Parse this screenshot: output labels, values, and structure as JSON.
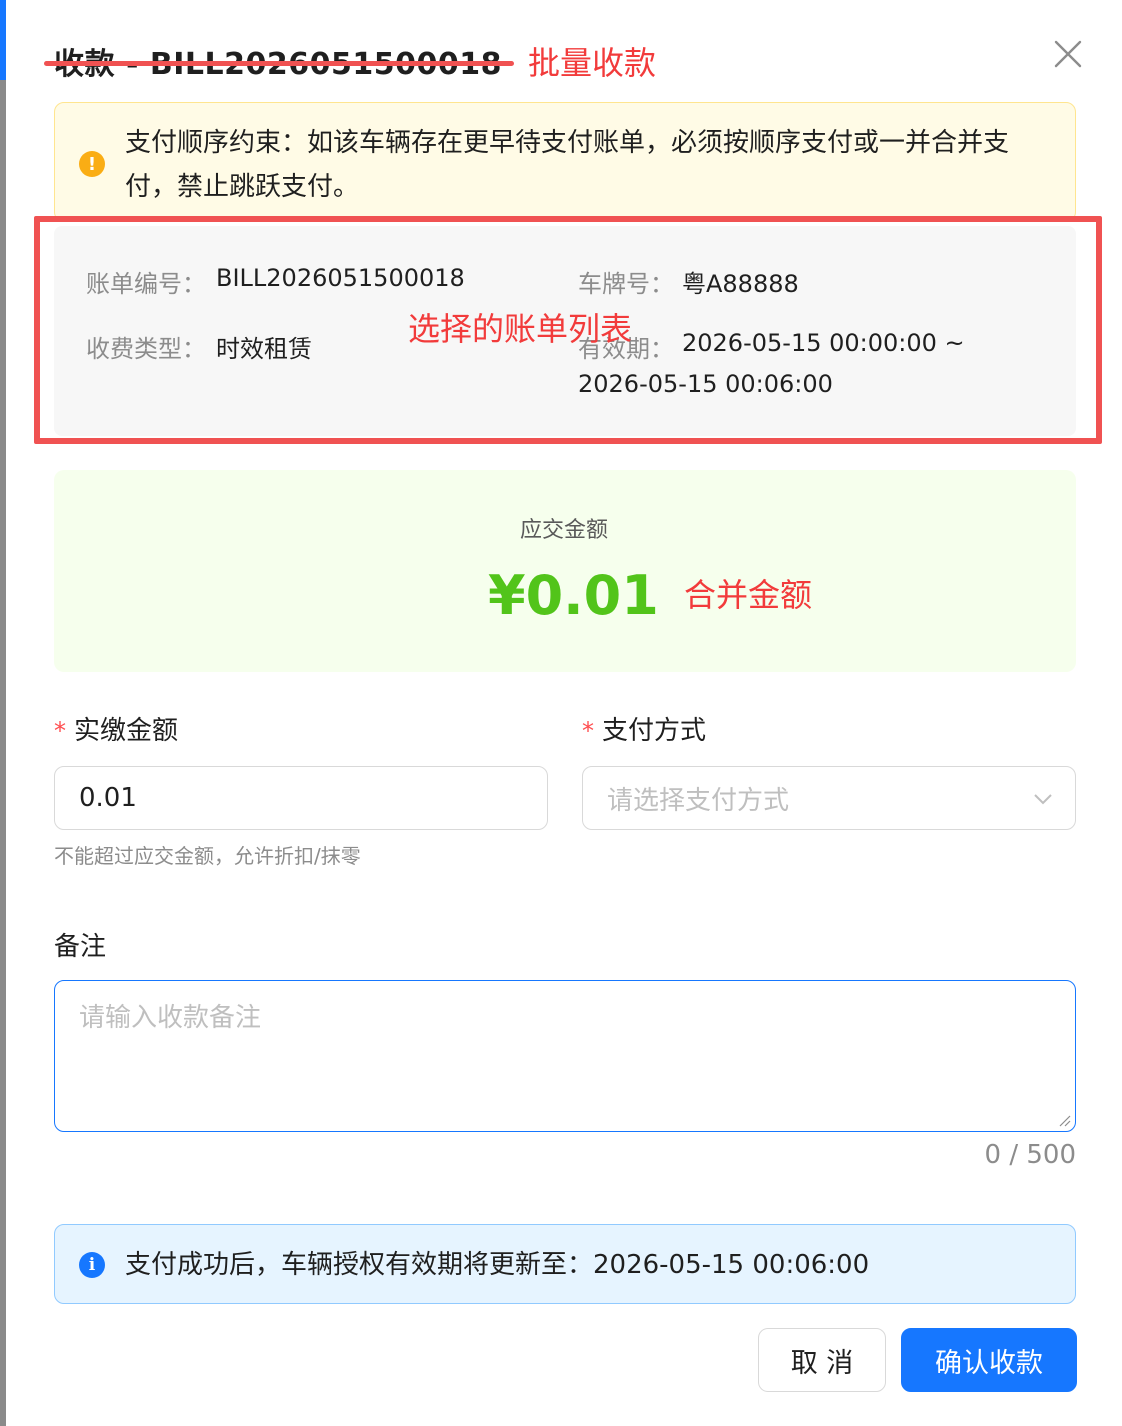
{
  "dialog": {
    "title": "收款 - BILL2026051500018",
    "title_annotation": "批量收款"
  },
  "warning": {
    "text": "支付顺序约束：如该车辆存在更早待支付账单，必须按顺序支付或一并合并支付，禁止跳跃支付。"
  },
  "bill": {
    "annotation": "选择的账单列表",
    "bill_no_label": "账单编号：",
    "bill_no": "BILL2026051500018",
    "plate_label": "车牌号：",
    "plate": "粤A88888",
    "fee_type_label": "收费类型：",
    "fee_type": "时效租赁",
    "validity_label": "有效期：",
    "validity_start": "2026-05-15 00:00:00 ~",
    "validity_end": "2026-05-15 00:06:00"
  },
  "amount": {
    "label": "应交金额",
    "value": "¥0.01",
    "annotation": "合并金额"
  },
  "form": {
    "required_mark": "*",
    "paid_label": "实缴金额",
    "paid_value": "0.01",
    "paid_hint": "不能超过应交金额，允许折扣/抹零",
    "method_label": "支付方式",
    "method_placeholder": "请选择支付方式",
    "remark_label": "备注",
    "remark_placeholder": "请输入收款备注",
    "remark_counter": "0 / 500"
  },
  "info": {
    "text": "支付成功后，车辆授权有效期将更新至：2026-05-15 00:06:00"
  },
  "footer": {
    "cancel_label": "取 消",
    "confirm_label": "确认收款"
  },
  "colors": {
    "primary": "#1677ff",
    "success": "#52c41a",
    "warning": "#faad14",
    "annotation": "#f23b3b"
  }
}
